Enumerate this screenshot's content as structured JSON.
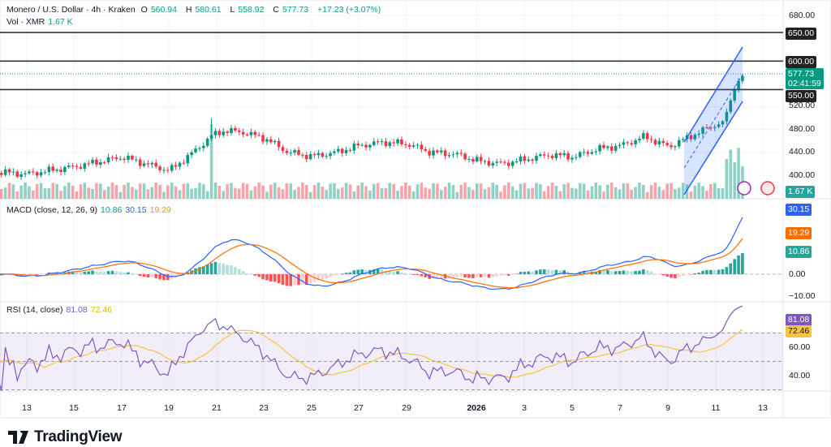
{
  "header": {
    "symbol": "Monero / U.S. Dollar · 4h · Kraken",
    "o_label": "O",
    "open": "560.94",
    "h_label": "H",
    "high": "580.61",
    "l_label": "L",
    "low": "558.92",
    "c_label": "C",
    "close": "577.73",
    "change": "+17.23 (+3.07%)",
    "vol_label": "Vol · XMR",
    "vol": "1.67 K"
  },
  "price_axis": [
    "680.00",
    "520.00",
    "480.00",
    "440.00",
    "400.00"
  ],
  "levels": [
    "650.00",
    "600.00",
    "550.00"
  ],
  "current": {
    "price": "577.73",
    "countdown": "02:41:59"
  },
  "volume_label": "1.67 K",
  "macd": {
    "title": "MACD (close, 12, 26, 9)",
    "hist": "10.86",
    "macd": "30.15",
    "signal": "19.29",
    "axis": [
      "0.00",
      "−10.00"
    ]
  },
  "rsi": {
    "title": "RSI (14, close)",
    "rsi": "81.08",
    "ma": "72.46",
    "axis": [
      "60.00",
      "40.00"
    ]
  },
  "x_axis": [
    "13",
    "15",
    "17",
    "19",
    "21",
    "23",
    "25",
    "27",
    "29",
    "2026",
    "3",
    "5",
    "7",
    "9",
    "11",
    "13"
  ],
  "logo": "TradingView",
  "colors": {
    "up": "#089981",
    "down": "#f23645",
    "macd": "#2962ff",
    "signal": "#ff6d00",
    "rsi": "#7e57c2",
    "rsi_ma": "#f5c542"
  },
  "chart_data": {
    "type": "candlestick",
    "timeframe": "4h",
    "price_path": [
      [
        -0.9,
        408
      ],
      [
        0,
        405
      ],
      [
        1,
        402
      ],
      [
        3,
        415
      ],
      [
        5,
        432
      ],
      [
        6,
        420
      ],
      [
        7,
        408
      ],
      [
        8,
        440
      ],
      [
        8.8,
        470
      ],
      [
        9.3,
        478
      ],
      [
        10,
        476
      ],
      [
        11,
        465
      ],
      [
        12,
        440
      ],
      [
        13,
        433
      ],
      [
        14,
        440
      ],
      [
        15,
        452
      ],
      [
        16,
        458
      ],
      [
        17,
        455
      ],
      [
        18,
        440
      ],
      [
        19,
        437
      ],
      [
        20,
        425
      ],
      [
        21,
        420
      ],
      [
        22,
        428
      ],
      [
        23,
        436
      ],
      [
        24,
        432
      ],
      [
        25,
        446
      ],
      [
        26,
        452
      ],
      [
        27,
        468
      ],
      [
        27.5,
        458
      ],
      [
        28,
        450
      ],
      [
        29,
        470
      ],
      [
        30.3,
        495
      ],
      [
        30.8,
        555
      ],
      [
        31.0,
        570
      ],
      [
        31.2,
        578
      ]
    ],
    "ylim": [
      380,
      690
    ],
    "levels": [
      650,
      600,
      550
    ]
  }
}
